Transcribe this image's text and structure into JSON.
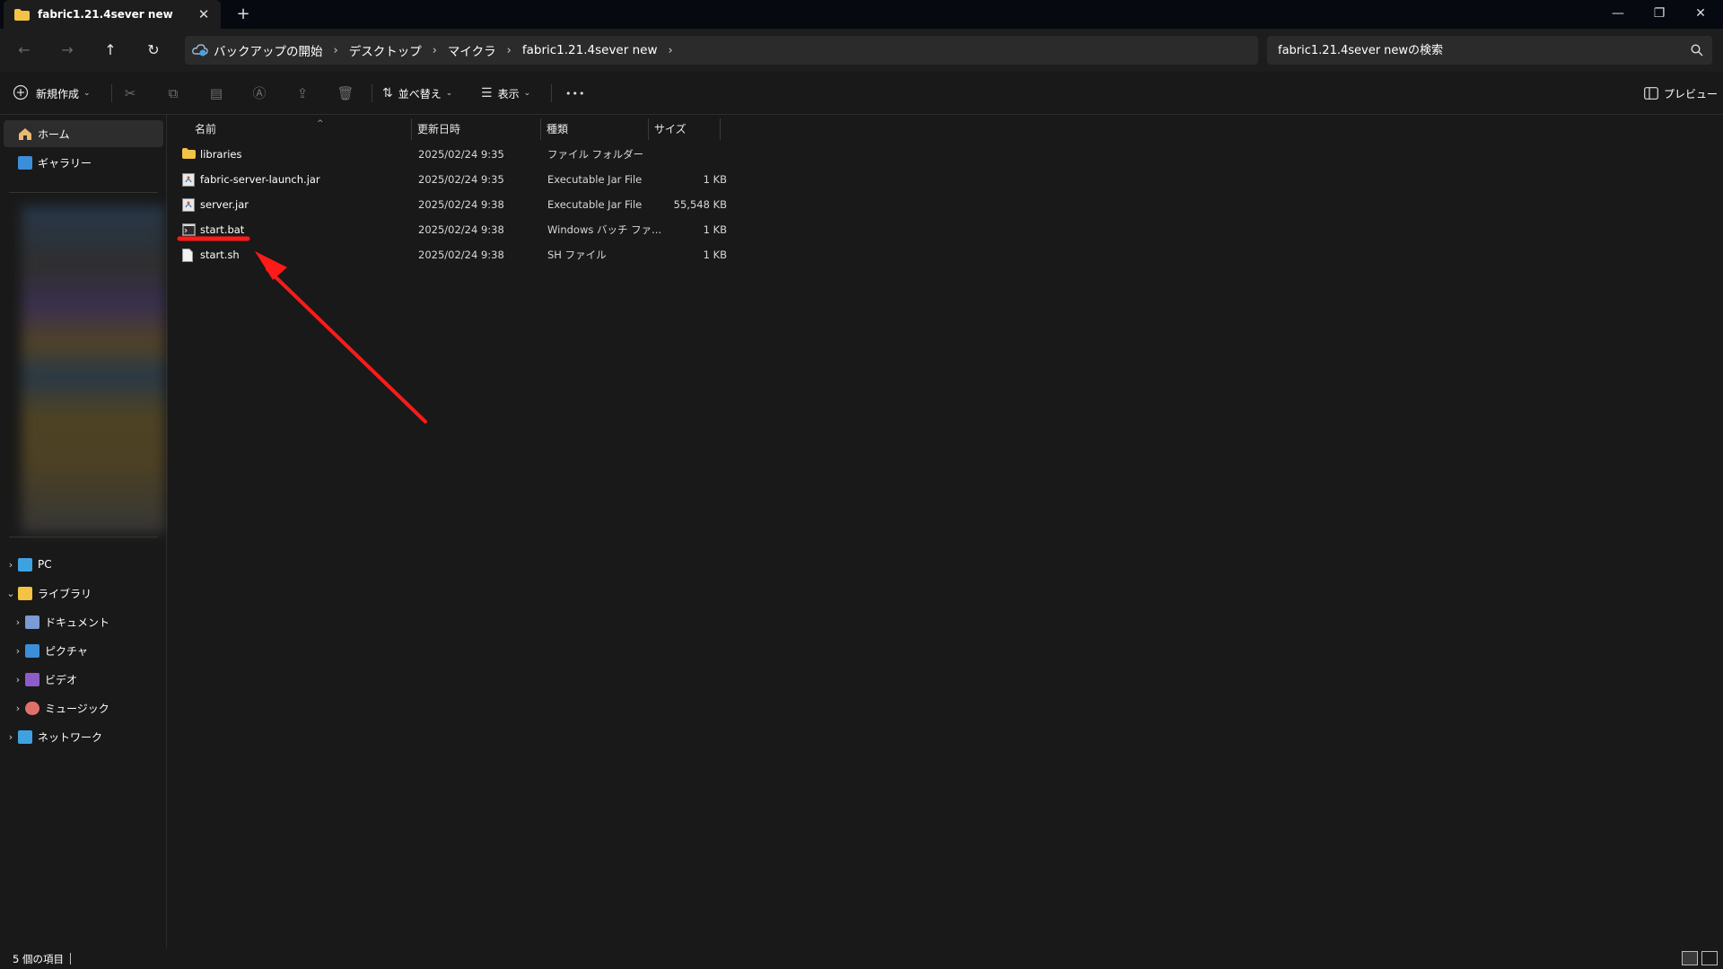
{
  "window": {
    "tab_title": "fabric1.21.4sever new",
    "tab_close": "✕",
    "new_tab": "+",
    "minimize": "—",
    "maximize": "❐",
    "close": "✕"
  },
  "nav": {
    "back": "←",
    "forward": "→",
    "up": "↑",
    "refresh": "↻"
  },
  "breadcrumbs": [
    "バックアップの開始",
    "デスクトップ",
    "マイクラ",
    "fabric1.21.4sever new"
  ],
  "search": {
    "placeholder": "fabric1.21.4sever newの検索"
  },
  "toolbar": {
    "new_label": "新規作成",
    "sort_label": "並べ替え",
    "view_label": "表示",
    "more_label": "•••",
    "preview_label": "プレビュー"
  },
  "sidebar": {
    "home": "ホーム",
    "gallery": "ギャラリー",
    "pc": "PC",
    "library": "ライブラリ",
    "documents": "ドキュメント",
    "pictures": "ピクチャ",
    "videos": "ビデオ",
    "music": "ミュージック",
    "network": "ネットワーク"
  },
  "columns": {
    "name": "名前",
    "date": "更新日時",
    "type": "種類",
    "size": "サイズ"
  },
  "files": [
    {
      "name": "libraries",
      "date": "2025/02/24 9:35",
      "type": "ファイル フォルダー",
      "size": "",
      "icon": "folder-icon"
    },
    {
      "name": "fabric-server-launch.jar",
      "date": "2025/02/24 9:35",
      "type": "Executable Jar File",
      "size": "1 KB",
      "icon": "jar-file-icon"
    },
    {
      "name": "server.jar",
      "date": "2025/02/24 9:38",
      "type": "Executable Jar File",
      "size": "55,548 KB",
      "icon": "jar-file-icon"
    },
    {
      "name": "start.bat",
      "date": "2025/02/24 9:38",
      "type": "Windows バッチ ファ...",
      "size": "1 KB",
      "icon": "bat-file-icon"
    },
    {
      "name": "start.sh",
      "date": "2025/02/24 9:38",
      "type": "SH ファイル",
      "size": "1 KB",
      "icon": "file-icon"
    }
  ],
  "status": {
    "item_count": "5 個の項目"
  },
  "colors": {
    "annotation": "#ff1a1a",
    "folder": "#f4c244",
    "accent": "#4aa3df"
  }
}
